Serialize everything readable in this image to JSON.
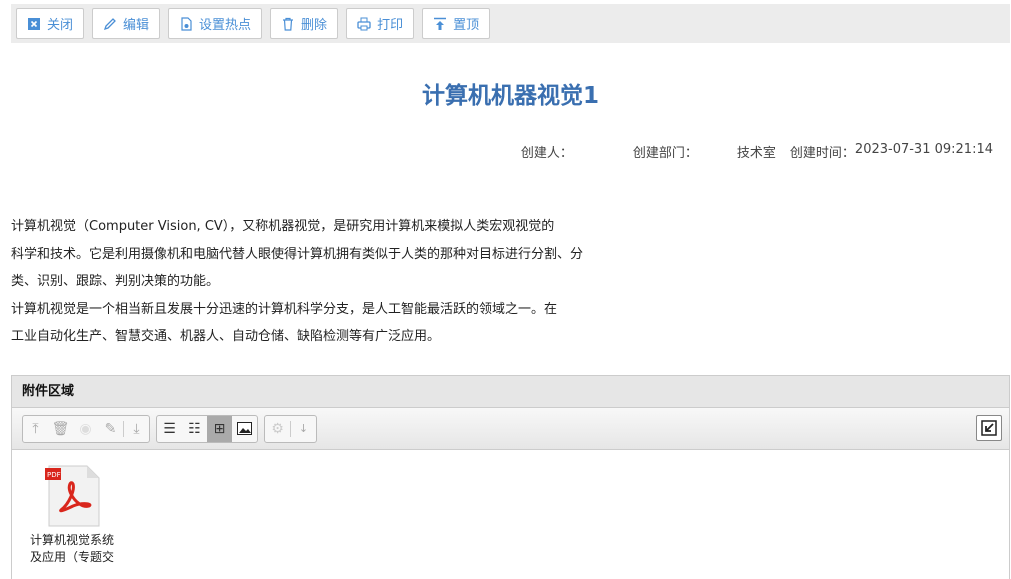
{
  "toolbar": {
    "close": "关闭",
    "edit": "编辑",
    "hotspot": "设置热点",
    "delete": "删除",
    "print": "打印",
    "top": "置顶"
  },
  "title": "计算机机器视觉1",
  "meta": {
    "creator_label": "创建人：",
    "creator": "",
    "dept_label": "创建部门：",
    "dept": "技术室",
    "time_label": "创建时间：",
    "time": "2023-07-31 09:21:14"
  },
  "content": [
    "计算机视觉（Computer Vision, CV），又称机器视觉，是研究用计算机来模拟人类宏观视觉的",
    "科学和技术。它是利用摄像机和电脑代替人眼使得计算机拥有类似于人类的那种对目标进行分割、分",
    "类、识别、跟踪、判别决策的功能。",
    "计算机视觉是一个相当新且发展十分迅速的计算机科学分支，是人工智能最活跃的领域之一。在",
    "工业自动化生产、智慧交通、机器人、自动仓储、缺陷检测等有广泛应用。"
  ],
  "attachments": {
    "header": "附件区域",
    "files": [
      {
        "name_line1": "计算机视觉系统",
        "name_line2": "及应用（专题交",
        "type": "PDF"
      }
    ]
  }
}
